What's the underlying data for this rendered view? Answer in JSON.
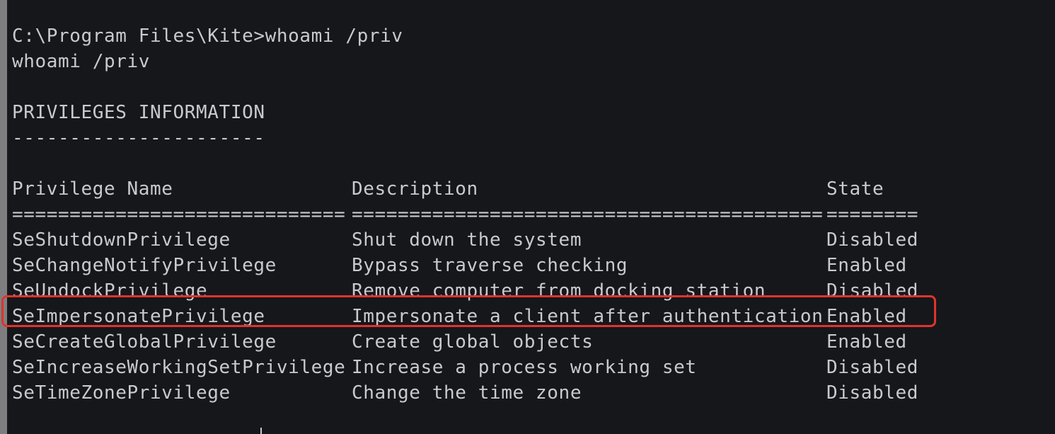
{
  "terminal": {
    "prompt_line": "C:\\Program Files\\Kite>whoami /priv",
    "echo_line": "whoami /priv",
    "section_title": "PRIVILEGES INFORMATION",
    "section_underline": "----------------------",
    "headers": {
      "name": "Privilege Name",
      "description": "Description",
      "state": "State"
    },
    "separators": {
      "name": "=============================",
      "description": "=========================================",
      "state": "========"
    },
    "rows": [
      {
        "name": "SeShutdownPrivilege",
        "description": "Shut down the system",
        "state": "Disabled"
      },
      {
        "name": "SeChangeNotifyPrivilege",
        "description": "Bypass traverse checking",
        "state": "Enabled"
      },
      {
        "name": "SeUndockPrivilege",
        "description": "Remove computer from docking station",
        "state": "Disabled"
      },
      {
        "name": "SeImpersonatePrivilege",
        "description": "Impersonate a client after authentication",
        "state": "Enabled"
      },
      {
        "name": "SeCreateGlobalPrivilege",
        "description": "Create global objects",
        "state": "Enabled"
      },
      {
        "name": "SeIncreaseWorkingSetPrivilege",
        "description": "Increase a process working set",
        "state": "Disabled"
      },
      {
        "name": "SeTimeZonePrivilege",
        "description": "Change the time zone",
        "state": "Disabled"
      }
    ],
    "highlighted_row": "SeImpersonatePrivilege",
    "colors": {
      "background": "#16171b",
      "text": "#c9cacd",
      "highlight_border": "#e0342a",
      "left_strip": "#7e7e80"
    }
  }
}
